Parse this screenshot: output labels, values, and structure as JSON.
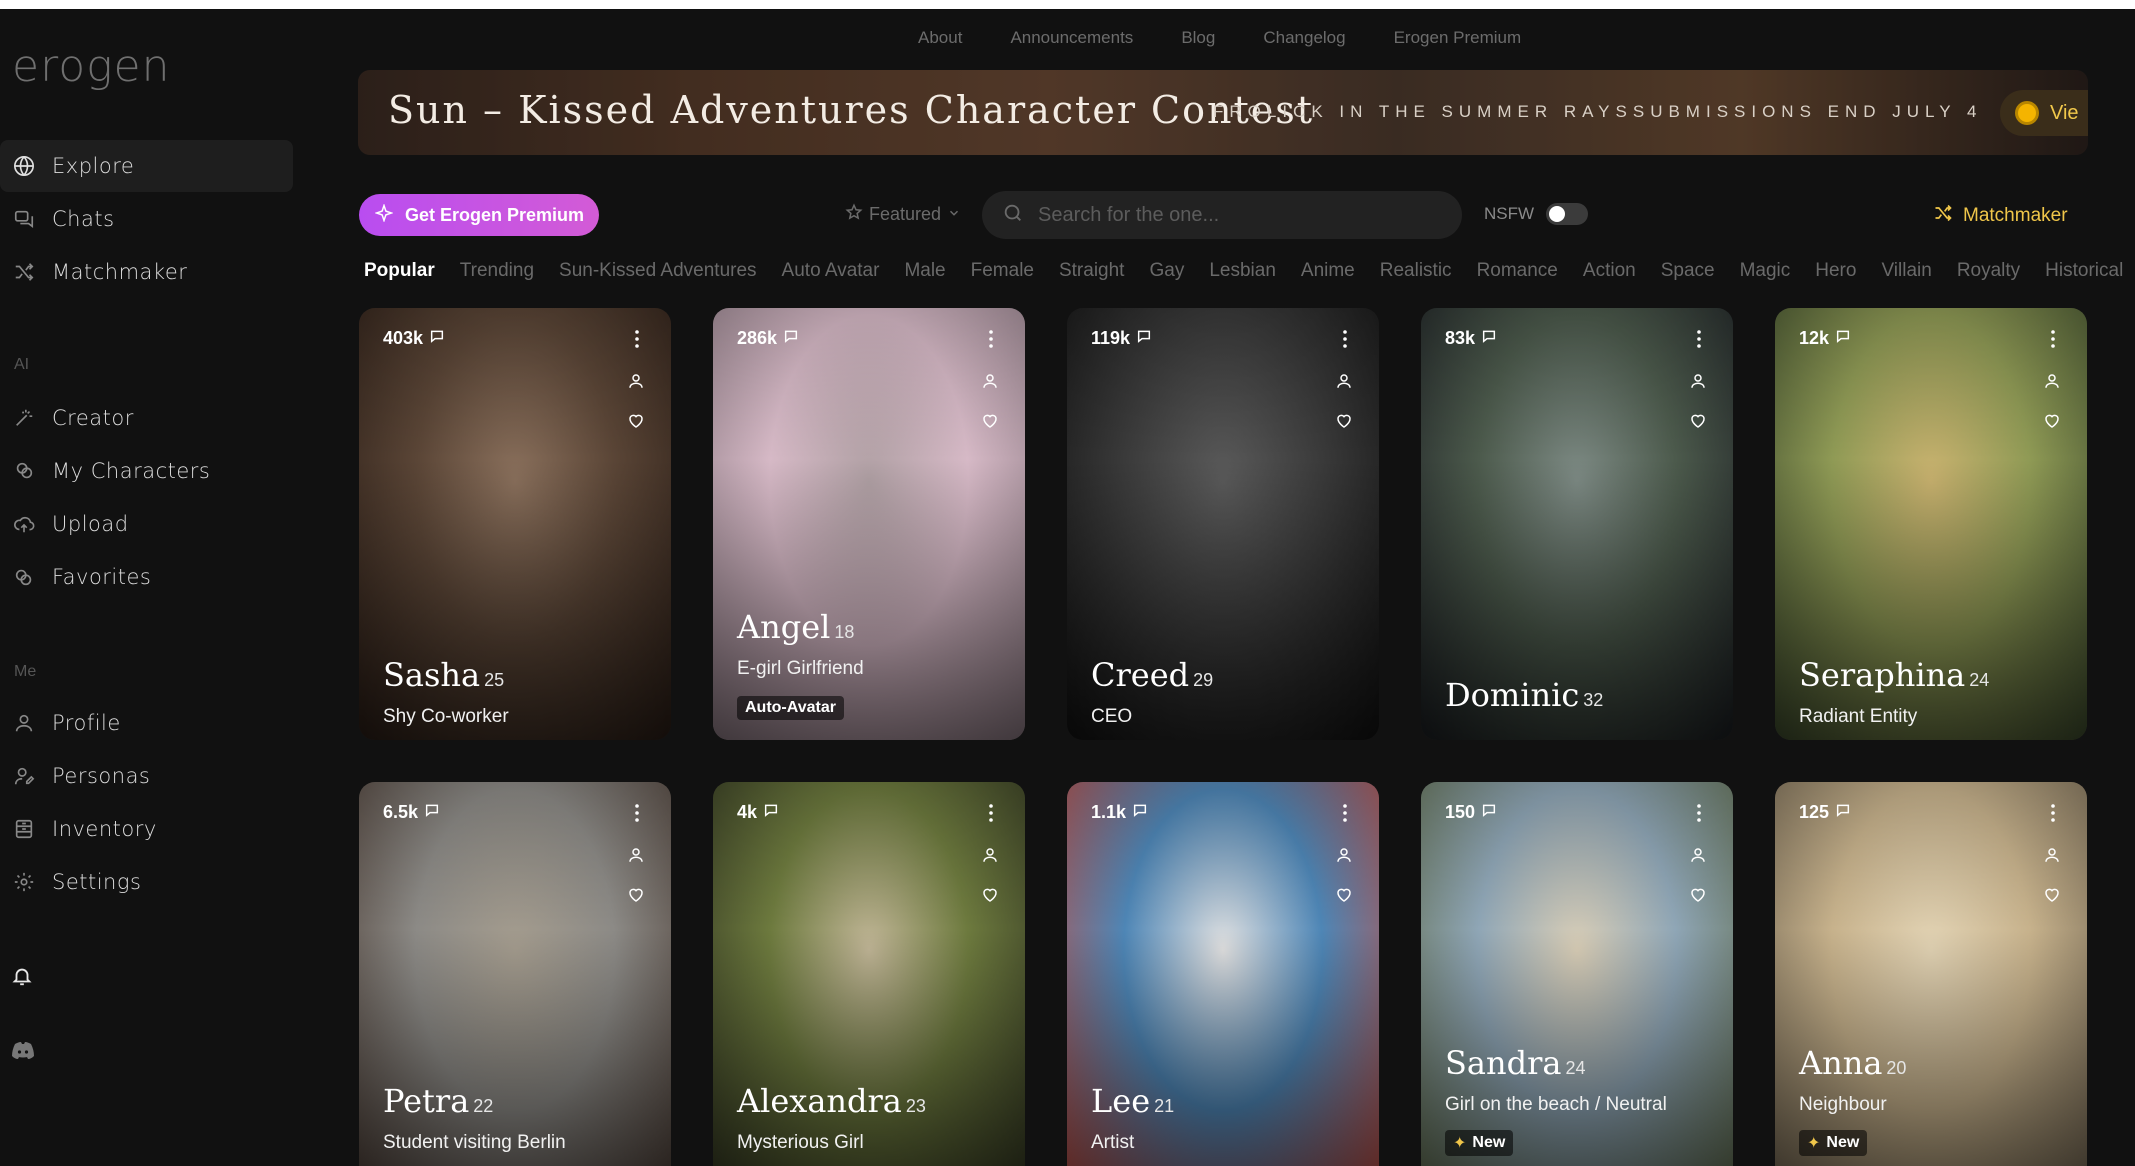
{
  "brand": {
    "logo": "erogen"
  },
  "sidebar": {
    "main": [
      {
        "label": "Explore",
        "icon": "globe-icon",
        "active": true
      },
      {
        "label": "Chats",
        "icon": "chat-icon"
      },
      {
        "label": "Matchmaker",
        "icon": "shuffle-icon"
      }
    ],
    "ai_label": "AI",
    "ai": [
      {
        "label": "Creator",
        "icon": "wand-icon"
      },
      {
        "label": "My Characters",
        "icon": "characters-icon"
      },
      {
        "label": "Upload",
        "icon": "cloud-upload-icon"
      },
      {
        "label": "Favorites",
        "icon": "hearts-icon"
      }
    ],
    "me_label": "Me",
    "me": [
      {
        "label": "Profile",
        "icon": "user-icon"
      },
      {
        "label": "Personas",
        "icon": "persona-icon"
      },
      {
        "label": "Inventory",
        "icon": "inventory-icon"
      },
      {
        "label": "Settings",
        "icon": "gear-icon"
      }
    ]
  },
  "toplinks": [
    "About",
    "Announcements",
    "Blog",
    "Changelog",
    "Erogen Premium"
  ],
  "banner": {
    "title": "Sun – Kissed  Adventures  Character  Contest",
    "subtitle": "FROLICK IN THE SUMMER RAYSSUBMISSIONS END JULY 4",
    "button": "Vie"
  },
  "controls": {
    "premium": "Get Erogen Premium",
    "sort": "Featured",
    "search_placeholder": "Search for the one...",
    "nsfw": "NSFW",
    "matchmaker": "Matchmaker"
  },
  "tags": [
    "Popular",
    "Trending",
    "Sun-Kissed Adventures",
    "Auto Avatar",
    "Male",
    "Female",
    "Straight",
    "Gay",
    "Lesbian",
    "Anime",
    "Realistic",
    "Romance",
    "Action",
    "Space",
    "Magic",
    "Hero",
    "Villain",
    "Royalty",
    "Historical"
  ],
  "active_tag": "Popular",
  "cards": [
    {
      "count": "403k",
      "name": "Sasha",
      "age": "25",
      "desc": "Shy Co-worker",
      "badge": "",
      "colors": [
        "#5a4536",
        "#2a1d16",
        "#8a705c"
      ]
    },
    {
      "count": "286k",
      "name": "Angel",
      "age": "18",
      "desc": "E-girl Girlfriend",
      "badge": "Auto-Avatar",
      "colors": [
        "#d6b9c6",
        "#8d7b84",
        "#b0a0a4"
      ]
    },
    {
      "count": "119k",
      "name": "Creed",
      "age": "29",
      "desc": "CEO",
      "badge": "",
      "colors": [
        "#3a3a3a",
        "#111111",
        "#5a5a5a"
      ]
    },
    {
      "count": "83k",
      "name": "Dominic",
      "age": "32",
      "desc": "",
      "badge": "",
      "colors": [
        "#4c5a4c",
        "#1b1e22",
        "#7d8a84"
      ]
    },
    {
      "count": "12k",
      "name": "Seraphina",
      "age": "24",
      "desc": "Radiant Entity",
      "badge": "",
      "colors": [
        "#8f9a55",
        "#3c4a2c",
        "#c9b26f"
      ]
    },
    {
      "count": "6.5k",
      "name": "Petra",
      "age": "22",
      "desc": "Student visiting Berlin",
      "badge": "",
      "colors": [
        "#8c8a86",
        "#4a3c34",
        "#a49c8e"
      ]
    },
    {
      "count": "4k",
      "name": "Alexandra",
      "age": "23",
      "desc": "Mysterious Girl",
      "badge": "",
      "colors": [
        "#6d7a3e",
        "#2f3320",
        "#c0b596"
      ]
    },
    {
      "count": "1.1k",
      "name": "Lee",
      "age": "21",
      "desc": "Artist",
      "badge": "",
      "colors": [
        "#4e86b6",
        "#c24a3c",
        "#e0e0e0"
      ]
    },
    {
      "count": "150",
      "name": "Sandra",
      "age": "24",
      "desc": "Girl on the beach / Neutral",
      "badge": "New",
      "colors": [
        "#8fa6b6",
        "#5e6a4a",
        "#d8cdb6"
      ]
    },
    {
      "count": "125",
      "name": "Anna",
      "age": "20",
      "desc": "Neighbour",
      "badge": "New",
      "colors": [
        "#c7b28c",
        "#6f6350",
        "#e2d3b4"
      ]
    }
  ]
}
